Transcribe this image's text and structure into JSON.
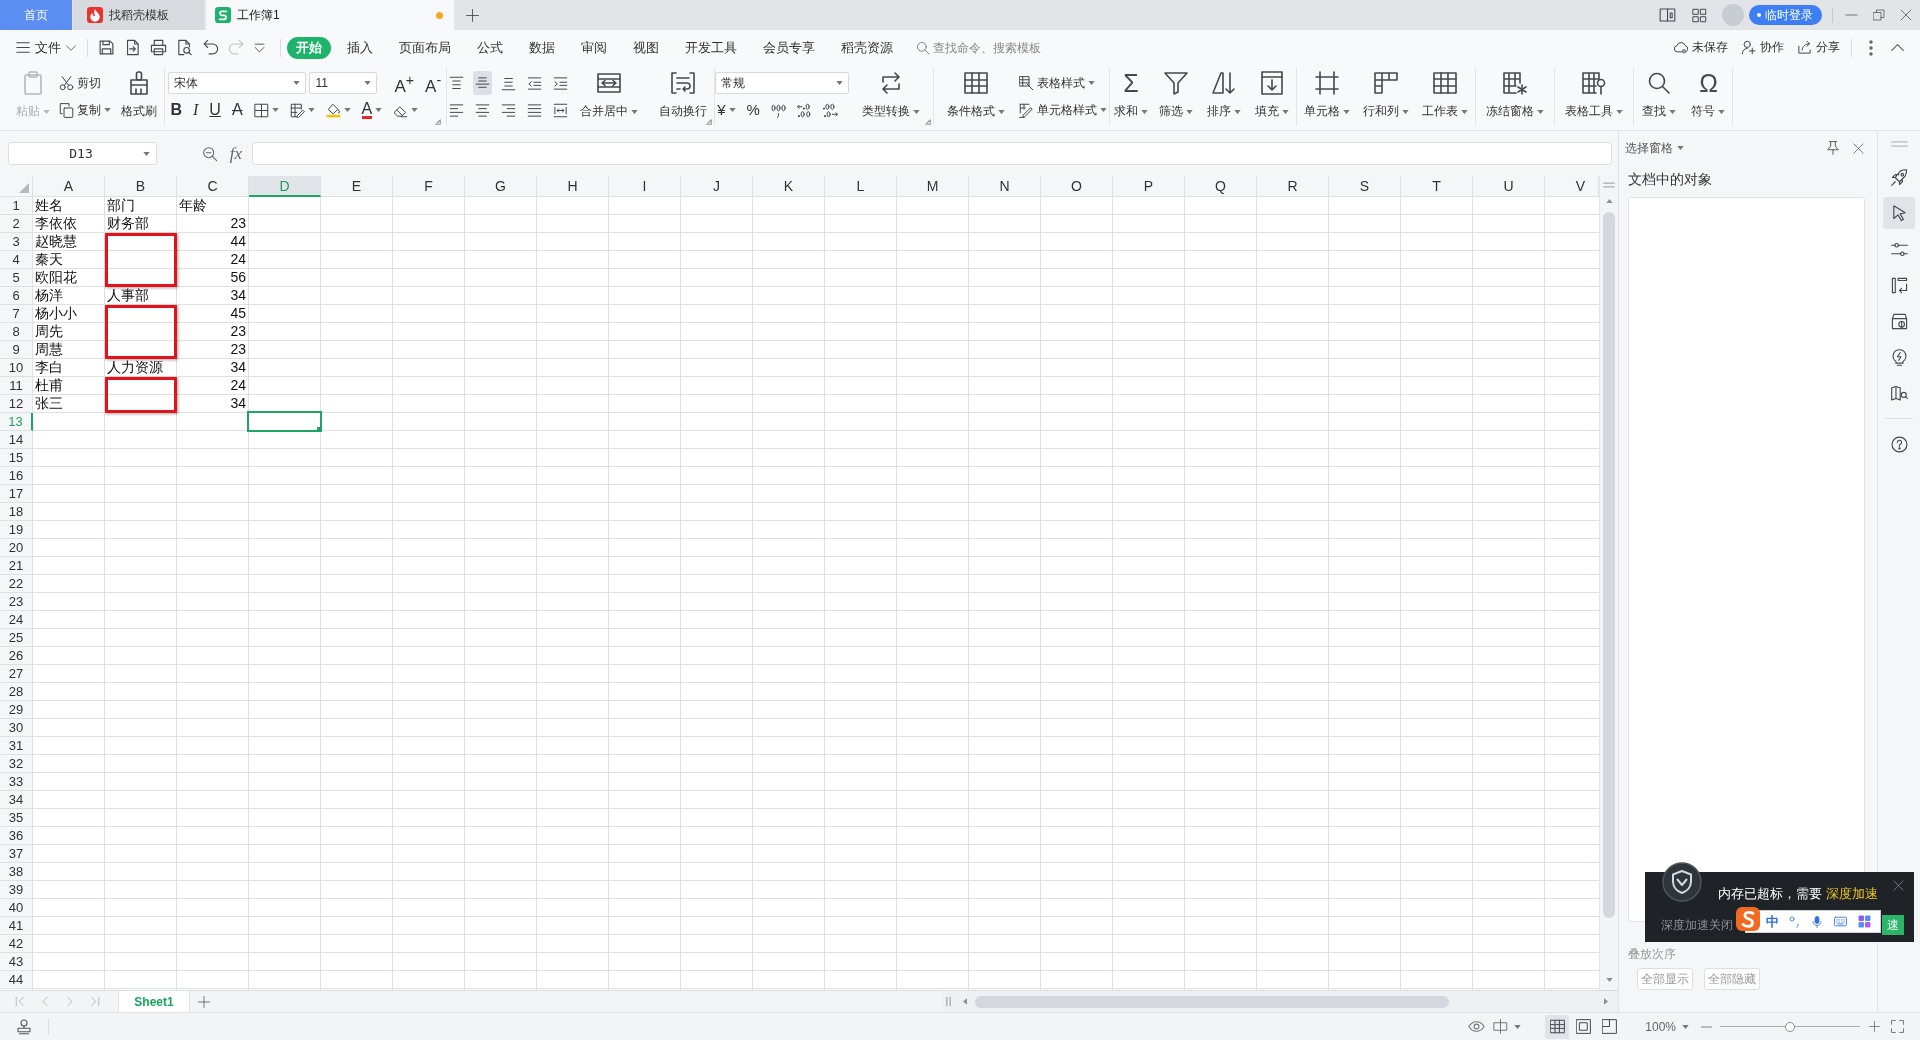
{
  "tab_bar": {
    "tabs": [
      {
        "kind": "home",
        "label": "首页",
        "selected": false,
        "unsaved": false
      },
      {
        "kind": "template",
        "label": "找稻壳模板",
        "selected": false,
        "unsaved": false
      },
      {
        "kind": "workbook",
        "label": "工作簿1",
        "selected": true,
        "unsaved": true
      }
    ],
    "login": "临时登录"
  },
  "menu_bar": {
    "file": "文件",
    "quick_access": [
      {
        "kind": "save",
        "disabled": false
      },
      {
        "kind": "export",
        "disabled": false
      },
      {
        "kind": "print",
        "disabled": false
      },
      {
        "kind": "preview",
        "disabled": false
      },
      {
        "kind": "undo",
        "disabled": false
      },
      {
        "kind": "redo",
        "disabled": true
      },
      {
        "kind": "customize",
        "disabled": false
      }
    ],
    "tabs": [
      {
        "label": "开始",
        "selected": true
      },
      {
        "label": "插入",
        "selected": false
      },
      {
        "label": "页面布局",
        "selected": false
      },
      {
        "label": "公式",
        "selected": false
      },
      {
        "label": "数据",
        "selected": false
      },
      {
        "label": "审阅",
        "selected": false
      },
      {
        "label": "视图",
        "selected": false
      },
      {
        "label": "开发工具",
        "selected": false
      },
      {
        "label": "会员专享",
        "selected": false
      },
      {
        "label": "稻壳资源",
        "selected": false
      }
    ],
    "search": {
      "placeholder": "查找命令、搜索模板"
    },
    "actions": [
      {
        "kind": "cloud",
        "label": "未保存"
      },
      {
        "kind": "collaborate",
        "label": "协作"
      },
      {
        "kind": "share",
        "label": "分享"
      }
    ]
  },
  "ribbon": {
    "groups": [
      {
        "kind": "clipboard",
        "launcher": false,
        "controls": [
          {
            "kind": "large",
            "item": {
              "kind": "paste",
              "label": "粘贴",
              "dropdown": true,
              "disabled": true
            }
          },
          {
            "kind": "stack",
            "top": [
              {
                "kind": "cut",
                "label": "剪切",
                "dropdown": false,
                "disabled": false
              }
            ],
            "bottom": [
              {
                "kind": "copy",
                "label": "复制",
                "dropdown": true,
                "disabled": false
              }
            ]
          },
          {
            "kind": "large",
            "item": {
              "kind": "brush",
              "label": "格式刷",
              "dropdown": false,
              "disabled": false
            }
          }
        ]
      },
      {
        "kind": "font",
        "launcher": true,
        "controls": [
          {
            "kind": "stack",
            "top": [
              {
                "kind": "font-name",
                "value": "宋体",
                "dropdown": true
              },
              {
                "kind": "font-size",
                "value": "11",
                "dropdown": true
              },
              {
                "kind": "grow",
                "glyph": "A$^{+}$",
                "dropdown": false
              },
              {
                "kind": "shrink",
                "glyph": "A$^{-}$",
                "dropdown": false
              }
            ],
            "bottom": [
              {
                "kind": "bold",
                "glyph": "B",
                "dropdown": false
              },
              {
                "kind": "italic",
                "glyph": "I",
                "dropdown": false
              },
              {
                "kind": "underline",
                "glyph": "U",
                "dropdown": false
              },
              {
                "kind": "strike",
                "glyph": "A",
                "dropdown": false
              },
              {
                "kind": "borders",
                "dropdown": true
              },
              {
                "kind": "cell-format",
                "dropdown": true
              },
              {
                "kind": "fill",
                "dropdown": true
              },
              {
                "kind": "font-color",
                "glyph": "A",
                "dropdown": true
              },
              {
                "kind": "clear",
                "dropdown": true
              }
            ]
          }
        ]
      },
      {
        "kind": "align",
        "launcher": true,
        "controls": [
          {
            "kind": "stack",
            "top": [
              {
                "kind": "align-top",
                "selected": false,
                "dropdown": false
              },
              {
                "kind": "align-middle",
                "selected": true,
                "dropdown": false
              },
              {
                "kind": "align-bottom",
                "selected": false,
                "dropdown": false
              },
              {
                "kind": "outdent",
                "selected": false,
                "dropdown": false
              },
              {
                "kind": "indent",
                "selected": false,
                "dropdown": false
              }
            ],
            "bottom": [
              {
                "kind": "align-left",
                "selected": false,
                "dropdown": false
              },
              {
                "kind": "align-center",
                "selected": false,
                "dropdown": false
              },
              {
                "kind": "align-right",
                "selected": false,
                "dropdown": false
              },
              {
                "kind": "justify",
                "selected": false,
                "dropdown": false
              },
              {
                "kind": "distribute",
                "selected": false,
                "dropdown": false
              }
            ]
          },
          {
            "kind": "large",
            "item": {
              "kind": "merge",
              "label": "合并居中",
              "dropdown": true
            }
          },
          {
            "kind": "large",
            "item": {
              "kind": "wrap",
              "label": "自动换行",
              "dropdown": false
            }
          }
        ]
      },
      {
        "kind": "number",
        "launcher": true,
        "controls": [
          {
            "kind": "stack",
            "top": [
              {
                "kind": "number-format",
                "value": "常规",
                "dropdown": true
              }
            ],
            "bottom": [
              {
                "kind": "currency",
                "glyph": "¥",
                "dropdown": true
              },
              {
                "kind": "percent",
                "glyph": "%",
                "dropdown": false
              },
              {
                "kind": "thousands",
                "dropdown": false
              },
              {
                "kind": "add-decimal",
                "dropdown": false
              },
              {
                "kind": "remove-decimal",
                "dropdown": false
              }
            ]
          },
          {
            "kind": "large",
            "item": {
              "kind": "convert",
              "label": "类型转换",
              "dropdown": true
            }
          }
        ]
      },
      {
        "kind": "styles",
        "launcher": false,
        "controls": [
          {
            "kind": "large",
            "item": {
              "kind": "conditional-format",
              "label": "条件格式",
              "dropdown": true
            }
          },
          {
            "kind": "stack",
            "top": [
              {
                "kind": "table-style",
                "label": "表格样式",
                "dropdown": true
              }
            ],
            "bottom": [
              {
                "kind": "cell-style",
                "label": "单元格样式",
                "dropdown": true
              }
            ]
          }
        ]
      },
      {
        "kind": "calc",
        "launcher": false,
        "controls": [
          {
            "kind": "large",
            "item": {
              "kind": "sum",
              "glyph": "Σ",
              "label": "求和",
              "dropdown": true
            }
          },
          {
            "kind": "large",
            "item": {
              "kind": "filter",
              "label": "筛选",
              "dropdown": true
            }
          },
          {
            "kind": "large",
            "item": {
              "kind": "sort",
              "label": "排序",
              "dropdown": true
            }
          },
          {
            "kind": "large",
            "item": {
              "kind": "fill-down",
              "label": "填充",
              "dropdown": true
            }
          }
        ]
      },
      {
        "kind": "cells",
        "launcher": false,
        "controls": [
          {
            "kind": "large",
            "item": {
              "kind": "cell",
              "label": "单元格",
              "dropdown": true
            }
          },
          {
            "kind": "large",
            "item": {
              "kind": "rows-columns",
              "label": "行和列",
              "dropdown": true
            }
          },
          {
            "kind": "large",
            "item": {
              "kind": "worksheet",
              "label": "工作表",
              "dropdown": true
            }
          }
        ]
      },
      {
        "kind": "freeze",
        "launcher": false,
        "controls": [
          {
            "kind": "large",
            "item": {
              "kind": "freeze",
              "label": "冻结窗格",
              "dropdown": true
            }
          }
        ]
      },
      {
        "kind": "tools",
        "launcher": false,
        "controls": [
          {
            "kind": "large",
            "item": {
              "kind": "tools",
              "label": "表格工具",
              "dropdown": true
            }
          }
        ]
      },
      {
        "kind": "find",
        "launcher": false,
        "controls": [
          {
            "kind": "large",
            "item": {
              "kind": "find",
              "label": "查找",
              "dropdown": true
            }
          },
          {
            "kind": "large",
            "item": {
              "kind": "symbol",
              "glyph": "Ω",
              "label": "符号",
              "dropdown": true
            }
          }
        ]
      }
    ]
  },
  "formula_bar": {
    "cell_reference": "D13",
    "function_label": "fx"
  },
  "sheet": {
    "columns": [
      {
        "label": "A",
        "selected": false
      },
      {
        "label": "B",
        "selected": false
      },
      {
        "label": "C",
        "selected": false
      },
      {
        "label": "D",
        "selected": true
      },
      {
        "label": "E",
        "selected": false
      },
      {
        "label": "F",
        "selected": false
      },
      {
        "label": "G",
        "selected": false
      },
      {
        "label": "H",
        "selected": false
      },
      {
        "label": "I",
        "selected": false
      },
      {
        "label": "J",
        "selected": false
      },
      {
        "label": "K",
        "selected": false
      },
      {
        "label": "L",
        "selected": false
      },
      {
        "label": "M",
        "selected": false
      },
      {
        "label": "N",
        "selected": false
      },
      {
        "label": "O",
        "selected": false
      },
      {
        "label": "P",
        "selected": false
      },
      {
        "label": "Q",
        "selected": false
      },
      {
        "label": "R",
        "selected": false
      },
      {
        "label": "S",
        "selected": false
      },
      {
        "label": "T",
        "selected": false
      },
      {
        "label": "U",
        "selected": false
      },
      {
        "label": "V",
        "selected": false
      }
    ],
    "rows": [
      {
        "label": "1",
        "selected": false,
        "cells": [
          {
            "text": "姓名",
            "kind": "text"
          },
          {
            "text": "部门",
            "kind": "text"
          },
          {
            "text": "年龄",
            "kind": "text"
          }
        ]
      },
      {
        "label": "2",
        "selected": false,
        "cells": [
          {
            "text": "李依依",
            "kind": "text"
          },
          {
            "text": "财务部",
            "kind": "text"
          },
          {
            "text": "23",
            "kind": "number"
          }
        ]
      },
      {
        "label": "3",
        "selected": false,
        "cells": [
          {
            "text": "赵晓慧",
            "kind": "text"
          },
          {
            "kind": "marked"
          },
          {
            "text": "44",
            "kind": "number"
          }
        ]
      },
      {
        "label": "4",
        "selected": false,
        "cells": [
          {
            "text": "秦天",
            "kind": "text"
          },
          {
            "kind": "marked"
          },
          {
            "text": "24",
            "kind": "number"
          }
        ]
      },
      {
        "label": "5",
        "selected": false,
        "cells": [
          {
            "text": "欧阳花",
            "kind": "text"
          },
          {
            "kind": "marked"
          },
          {
            "text": "56",
            "kind": "number"
          }
        ]
      },
      {
        "label": "6",
        "selected": false,
        "cells": [
          {
            "text": "杨洋",
            "kind": "text"
          },
          {
            "text": "人事部",
            "kind": "text"
          },
          {
            "text": "34",
            "kind": "number"
          }
        ]
      },
      {
        "label": "7",
        "selected": false,
        "cells": [
          {
            "text": "杨小小",
            "kind": "text"
          },
          {
            "kind": "marked"
          },
          {
            "text": "45",
            "kind": "number"
          }
        ]
      },
      {
        "label": "8",
        "selected": false,
        "cells": [
          {
            "text": "周先",
            "kind": "text"
          },
          {
            "kind": "marked"
          },
          {
            "text": "23",
            "kind": "number"
          }
        ]
      },
      {
        "label": "9",
        "selected": false,
        "cells": [
          {
            "text": "周慧",
            "kind": "text"
          },
          {
            "kind": "marked"
          },
          {
            "text": "23",
            "kind": "number"
          }
        ]
      },
      {
        "label": "10",
        "selected": false,
        "cells": [
          {
            "text": "李白",
            "kind": "text"
          },
          {
            "text": "人力资源",
            "kind": "text"
          },
          {
            "text": "34",
            "kind": "number"
          }
        ]
      },
      {
        "label": "11",
        "selected": false,
        "cells": [
          {
            "text": "杜甫",
            "kind": "text"
          },
          {
            "kind": "marked"
          },
          {
            "text": "24",
            "kind": "number"
          }
        ]
      },
      {
        "label": "12",
        "selected": false,
        "cells": [
          {
            "text": "张三",
            "kind": "text"
          },
          {
            "kind": "marked"
          },
          {
            "text": "34",
            "kind": "number"
          }
        ]
      },
      {
        "label": "13",
        "selected": true
      },
      {
        "label": "14",
        "selected": false
      },
      {
        "label": "15",
        "selected": false
      },
      {
        "label": "16",
        "selected": false
      },
      {
        "label": "17",
        "selected": false
      },
      {
        "label": "18",
        "selected": false
      },
      {
        "label": "19",
        "selected": false
      },
      {
        "label": "20",
        "selected": false
      },
      {
        "label": "21",
        "selected": false
      },
      {
        "label": "22",
        "selected": false
      },
      {
        "label": "23",
        "selected": false
      },
      {
        "label": "24",
        "selected": false
      },
      {
        "label": "25",
        "selected": false
      },
      {
        "label": "26",
        "selected": false
      },
      {
        "label": "27",
        "selected": false
      },
      {
        "label": "28",
        "selected": false
      },
      {
        "label": "29",
        "selected": false
      },
      {
        "label": "30",
        "selected": false
      },
      {
        "label": "31",
        "selected": false
      },
      {
        "label": "32",
        "selected": false
      },
      {
        "label": "33",
        "selected": false
      },
      {
        "label": "34",
        "selected": false
      },
      {
        "label": "35",
        "selected": false
      },
      {
        "label": "36",
        "selected": false
      },
      {
        "label": "37",
        "selected": false
      },
      {
        "label": "38",
        "selected": false
      },
      {
        "label": "39",
        "selected": false
      },
      {
        "label": "40",
        "selected": false
      },
      {
        "label": "41",
        "selected": false
      },
      {
        "label": "42",
        "selected": false
      },
      {
        "label": "43",
        "selected": false
      },
      {
        "label": "44",
        "selected": false
      }
    ]
  },
  "sheet_tabs": {
    "tabs": [
      {
        "label": "Sheet1",
        "selected": true
      }
    ]
  },
  "selection_pane": {
    "title": "选择窗格",
    "heading": "文档中的对象",
    "order_label": "叠放次序",
    "buttons": [
      {
        "label": "全部显示"
      },
      {
        "label": "全部隐藏"
      }
    ]
  },
  "side_toolbar": {
    "tools": [
      {
        "kind": "rocket",
        "selected": false
      },
      {
        "kind": "pointer",
        "selected": true
      },
      {
        "kind": "sliders",
        "selected": false
      },
      {
        "kind": "layout",
        "selected": false
      },
      {
        "kind": "theme",
        "selected": false
      },
      {
        "kind": "bolt",
        "selected": false
      },
      {
        "kind": "book",
        "selected": false
      }
    ],
    "footer_tools": [
      {
        "kind": "help",
        "selected": false
      }
    ]
  },
  "status_bar": {
    "views": [
      {
        "kind": "normal",
        "selected": true
      },
      {
        "kind": "page-layout",
        "selected": false
      },
      {
        "kind": "page-break",
        "selected": false
      }
    ],
    "zoom": "100%",
    "zoom_slider": {
      "level": 0.5
    }
  },
  "notification": {
    "message": "内存已超标，需要",
    "link": "深度加速",
    "secondary": "深度加速关闭",
    "button": "速"
  },
  "input_method_bar": {
    "mode": "中"
  }
}
